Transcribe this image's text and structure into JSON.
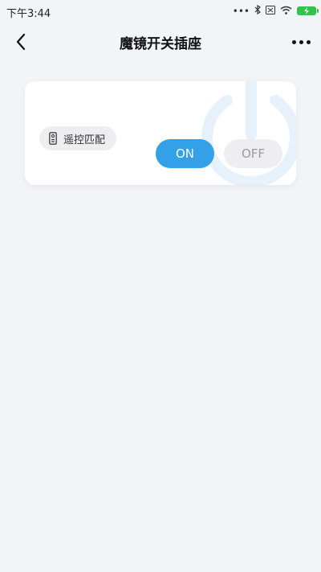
{
  "status_bar": {
    "time": "下午3:44",
    "icons": [
      "more-dots-icon",
      "bluetooth-icon",
      "sim-icon",
      "wifi-icon",
      "battery-charging-icon"
    ]
  },
  "nav": {
    "title": "魔镜开关插座",
    "back_icon": "chevron-left-icon",
    "more_icon": "more-horizontal-icon"
  },
  "card": {
    "remote_match_label": "遥控匹配",
    "remote_icon": "remote-control-icon",
    "on_label": "ON",
    "off_label": "OFF",
    "watermark_icon": "power-icon",
    "active": "ON"
  },
  "colors": {
    "accent": "#33a0e8",
    "background": "#f3f4f8",
    "battery": "#33c24a"
  }
}
